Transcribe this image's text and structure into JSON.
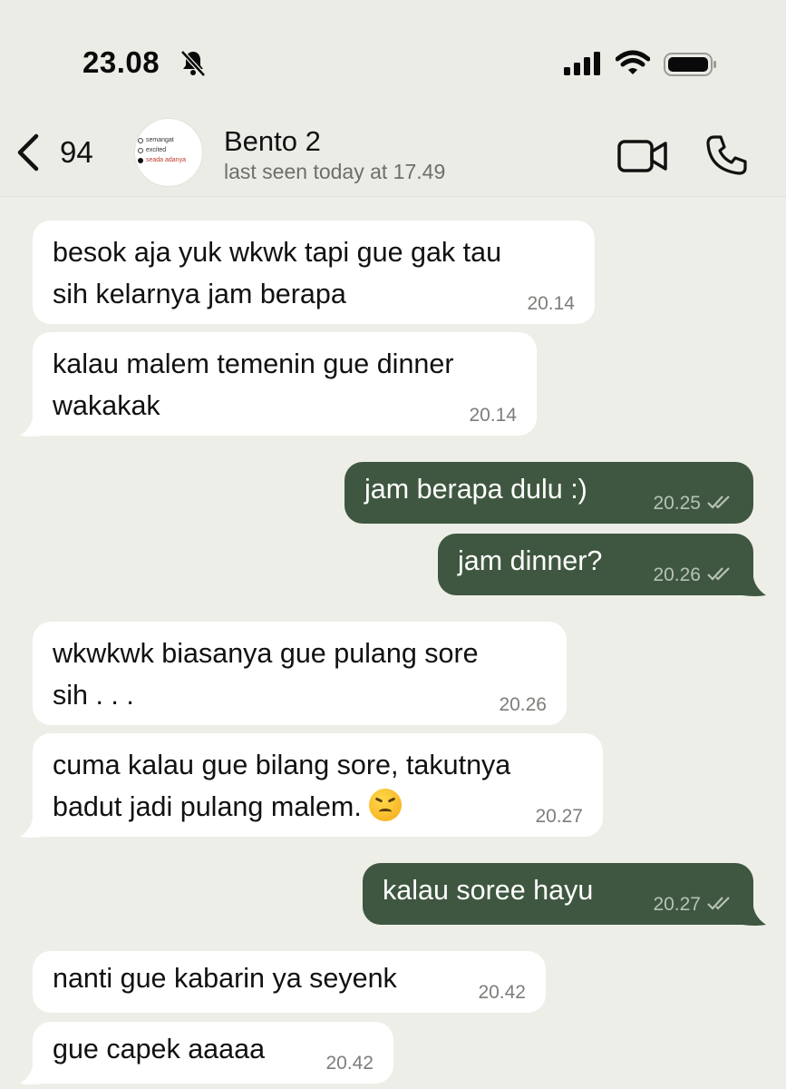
{
  "status": {
    "time": "23.08"
  },
  "header": {
    "back_count": "94",
    "avatar_options": [
      "semangat",
      "excited",
      "seada adanya"
    ],
    "contact_name": "Bento 2",
    "last_seen": "last seen today at 17.49"
  },
  "colors": {
    "incoming": "#ffffff",
    "outgoing": "#3f5740",
    "background": "#eeeee8"
  },
  "messages": [
    {
      "dir": "in",
      "text": "besok aja yuk wkwk tapi gue gak tau\nsih kelarnya jam berapa",
      "time": "20.14"
    },
    {
      "dir": "in",
      "text": "kalau malem temenin gue dinner\nwakakak",
      "time": "20.14"
    },
    {
      "dir": "out",
      "text": "jam berapa dulu :)",
      "time": "20.25",
      "status": "read"
    },
    {
      "dir": "out",
      "text": "jam dinner?",
      "time": "20.26",
      "status": "read"
    },
    {
      "dir": "in",
      "text": "wkwkwk biasanya gue pulang sore\nsih . . .",
      "time": "20.26"
    },
    {
      "dir": "in",
      "text": "cuma kalau gue bilang sore, takutnya\nbadut jadi pulang malem.",
      "emoji": "persevering-face",
      "time": "20.27"
    },
    {
      "dir": "out",
      "text": "kalau soree hayu",
      "time": "20.27",
      "status": "read"
    },
    {
      "dir": "in",
      "text": "nanti gue kabarin ya seyenk",
      "time": "20.42"
    },
    {
      "dir": "in",
      "text": "gue capek aaaaa",
      "time": "20.42"
    }
  ]
}
